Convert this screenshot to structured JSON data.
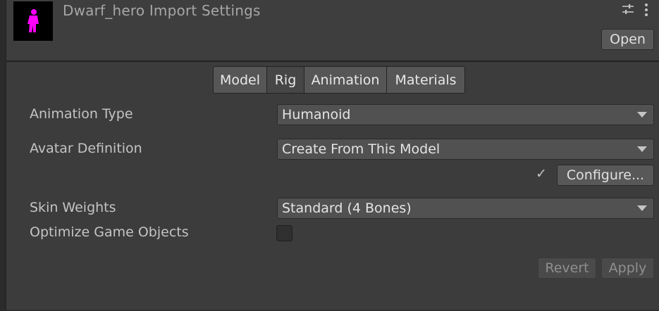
{
  "header": {
    "title": "Dwarf_hero Import Settings",
    "open_label": "Open",
    "icons": [
      "model-thumbnail-icon",
      "sliders-icon",
      "more-vertical-icon"
    ]
  },
  "tabs": [
    {
      "label": "Model",
      "active": false
    },
    {
      "label": "Rig",
      "active": true
    },
    {
      "label": "Animation",
      "active": false
    },
    {
      "label": "Materials",
      "active": false
    }
  ],
  "fields": {
    "animation_type": {
      "label": "Animation Type",
      "value": "Humanoid"
    },
    "avatar_definition": {
      "label": "Avatar Definition",
      "value": "Create From This Model"
    },
    "configure_label": "Configure...",
    "skin_weights": {
      "label": "Skin Weights",
      "value": "Standard (4 Bones)"
    },
    "optimize_game_objects": {
      "label": "Optimize Game Objects",
      "checked": false
    }
  },
  "actions": {
    "revert_label": "Revert",
    "apply_label": "Apply"
  },
  "colors": {
    "thumbnail_figure": "#ff00ff",
    "background": "#3c3c3c"
  }
}
